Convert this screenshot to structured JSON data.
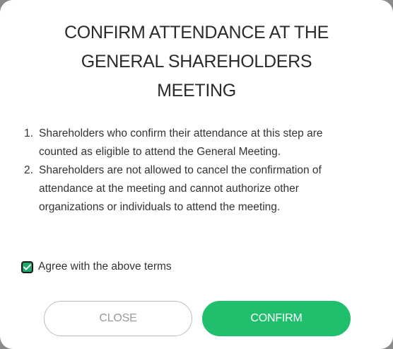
{
  "dialog": {
    "title_lines": [
      "CONFIRM ATTENDANCE AT THE",
      "GENERAL SHAREHOLDERS",
      "MEETING"
    ],
    "terms": [
      {
        "number": "1.",
        "text": "Shareholders who confirm their attendance at this step are counted as eligible to attend the General Meeting."
      },
      {
        "number": "2.",
        "text": "Shareholders are not allowed to cancel the confirmation of attendance at the meeting and cannot authorize other organizations or individuals to attend the meeting."
      }
    ],
    "agree": {
      "label": "Agree with the above terms",
      "checked": true
    },
    "buttons": {
      "close_label": "CLOSE",
      "confirm_label": "CONFIRM"
    }
  },
  "colors": {
    "accent": "#1fbf6d",
    "checkbox_fill": "#20a86b",
    "title_text": "#2b2b2b",
    "close_text": "#9a9a9a"
  },
  "icons": {
    "checkbox": "check-icon"
  }
}
